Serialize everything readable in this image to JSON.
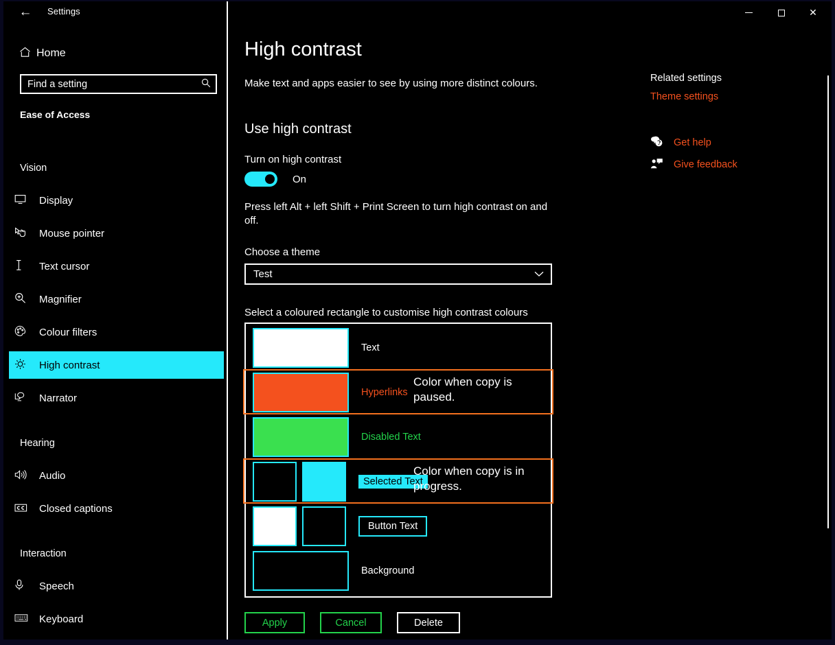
{
  "window": {
    "title": "Settings",
    "back_icon": "back-arrow-icon",
    "minimize_label": "",
    "maximize_label": "",
    "close_label": "✕"
  },
  "sidebar": {
    "home": {
      "label": "Home",
      "icon": "home-icon"
    },
    "search": {
      "value": "Find a setting",
      "placeholder": "Find a setting",
      "icon": "search-icon"
    },
    "category": "Ease of Access",
    "groups": [
      {
        "title": "Vision",
        "items": [
          {
            "label": "Display",
            "icon": "monitor-icon",
            "selected": false
          },
          {
            "label": "Mouse pointer",
            "icon": "mouse-pointer-icon",
            "selected": false
          },
          {
            "label": "Text cursor",
            "icon": "text-cursor-icon",
            "selected": false
          },
          {
            "label": "Magnifier",
            "icon": "magnifier-icon",
            "selected": false
          },
          {
            "label": "Colour filters",
            "icon": "palette-icon",
            "selected": false
          },
          {
            "label": "High contrast",
            "icon": "brightness-icon",
            "selected": true
          },
          {
            "label": "Narrator",
            "icon": "narrator-icon",
            "selected": false
          }
        ]
      },
      {
        "title": "Hearing",
        "items": [
          {
            "label": "Audio",
            "icon": "speaker-icon",
            "selected": false
          },
          {
            "label": "Closed captions",
            "icon": "closed-captions-icon",
            "selected": false
          }
        ]
      },
      {
        "title": "Interaction",
        "items": [
          {
            "label": "Speech",
            "icon": "microphone-icon",
            "selected": false
          },
          {
            "label": "Keyboard",
            "icon": "keyboard-icon",
            "selected": false
          }
        ]
      }
    ]
  },
  "main": {
    "heading": "High contrast",
    "subtitle": "Make text and apps easier to see by using more distinct colours.",
    "section_heading": "Use high contrast",
    "toggle_label": "Turn on high contrast",
    "toggle_state": "On",
    "shortcut_hint": "Press left Alt + left Shift + Print Screen to turn high contrast on and off.",
    "theme_label": "Choose a theme",
    "theme_value": "Test",
    "theme_chevron": "chevron-down-icon",
    "swatch_instruction": "Select a coloured rectangle to customise high contrast colours",
    "swatches": [
      {
        "caption": "Text",
        "style": "plain",
        "colors": [
          "#ffffff"
        ]
      },
      {
        "caption": "Hyperlinks",
        "style": "hyperlink",
        "colors": [
          "#f4511e"
        ]
      },
      {
        "caption": "Disabled Text",
        "style": "disabled",
        "colors": [
          "#3ae04f"
        ]
      },
      {
        "caption": "Selected Text",
        "style": "selected",
        "colors": [
          "#000000",
          "#25e9fb"
        ]
      },
      {
        "caption": "Button Text",
        "style": "button",
        "colors": [
          "#ffffff",
          "#000000"
        ]
      },
      {
        "caption": "Background",
        "style": "plain",
        "colors": [
          "#000000"
        ]
      }
    ],
    "annotations": [
      {
        "id": "paused",
        "text": "Color when copy is paused.",
        "target": "Hyperlinks"
      },
      {
        "id": "in-progress",
        "text": "Color when copy is in progress.",
        "target": "Selected Text"
      }
    ],
    "buttons": {
      "apply": "Apply",
      "cancel": "Cancel",
      "delete": "Delete"
    }
  },
  "rail": {
    "heading": "Related settings",
    "link": "Theme settings",
    "items": [
      {
        "label": "Get help",
        "icon": "help-bubble-icon"
      },
      {
        "label": "Give feedback",
        "icon": "feedback-icon"
      }
    ]
  },
  "colors": {
    "accent_cyan": "#25e9fb",
    "accent_orange": "#f4511e",
    "annotation_orange": "#f4701e",
    "green": "#23d34b",
    "background": "#000000",
    "window_border": "#08081e"
  }
}
